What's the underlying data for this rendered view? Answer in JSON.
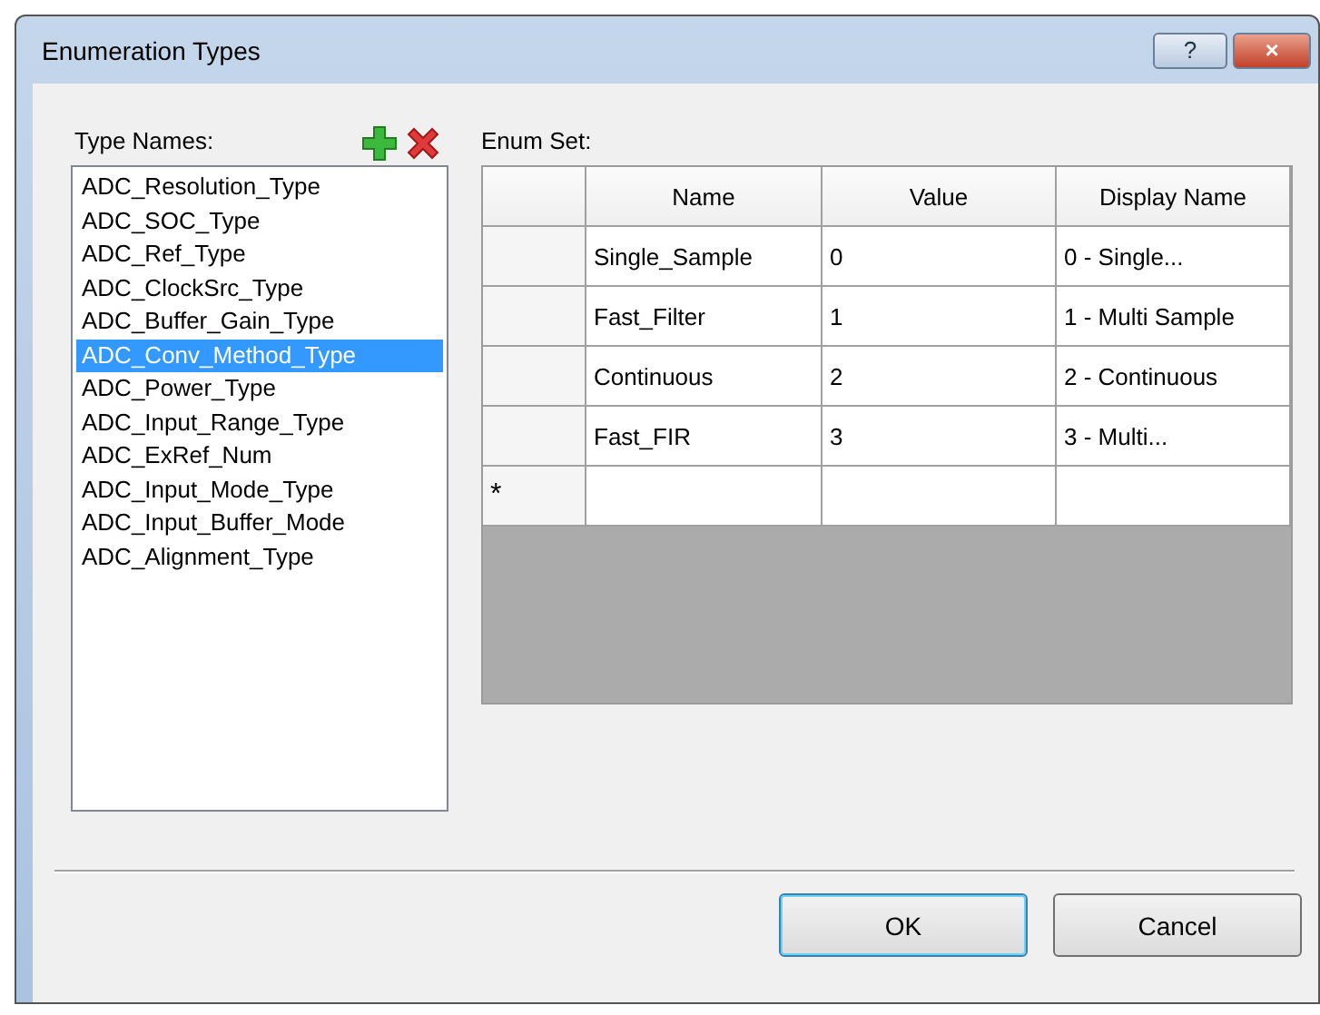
{
  "window": {
    "title": "Enumeration Types",
    "buttons": [
      "?",
      "×"
    ]
  },
  "type_names": {
    "label": "Type Names:",
    "items": [
      {
        "label": "ADC_Resolution_Type",
        "selected": false
      },
      {
        "label": "ADC_SOC_Type",
        "selected": false
      },
      {
        "label": "ADC_Ref_Type",
        "selected": false
      },
      {
        "label": "ADC_ClockSrc_Type",
        "selected": false
      },
      {
        "label": "ADC_Buffer_Gain_Type",
        "selected": false
      },
      {
        "label": "ADC_Conv_Method_Type",
        "selected": true
      },
      {
        "label": "ADC_Power_Type",
        "selected": false
      },
      {
        "label": "ADC_Input_Range_Type",
        "selected": false
      },
      {
        "label": "ADC_ExRef_Num",
        "selected": false
      },
      {
        "label": "ADC_Input_Mode_Type",
        "selected": false
      },
      {
        "label": "ADC_Input_Buffer_Mode",
        "selected": false
      },
      {
        "label": "ADC_Alignment_Type",
        "selected": false
      }
    ]
  },
  "enum_set": {
    "label": "Enum Set:",
    "columns": [
      "Name",
      "Value",
      "Display Name"
    ],
    "rows": [
      [
        "Single_Sample",
        "0",
        "0 - Single..."
      ],
      [
        "Fast_Filter",
        "1",
        "1 - Multi Sample"
      ],
      [
        "Continuous",
        "2",
        "2 - Continuous"
      ],
      [
        "Fast_FIR",
        "3",
        "3 - Multi..."
      ]
    ],
    "new_row_marker": "*"
  },
  "buttons": [
    "OK",
    "Cancel"
  ]
}
